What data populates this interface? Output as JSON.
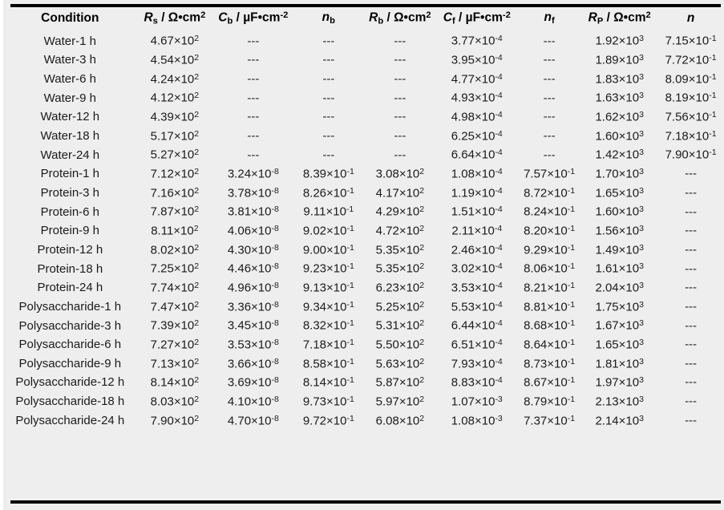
{
  "figure": {
    "background_color": "#eeeeee",
    "rule_color": "#000000",
    "text_color": "#1b1b1b"
  },
  "table": {
    "columns": [
      {
        "key": "condition",
        "label_plain": "Condition",
        "symbol": "",
        "subscript": "",
        "units": ""
      },
      {
        "key": "Rs",
        "label_plain": "Rs / Ω•cm2",
        "symbol": "R",
        "subscript": "s",
        "units": "/ Ω•cm",
        "unit_exp": "2"
      },
      {
        "key": "Cb",
        "label_plain": "Cb / µF•cm-2",
        "symbol": "C",
        "subscript": "b",
        "units": "/ µF•cm",
        "unit_exp": "-2"
      },
      {
        "key": "nb",
        "label_plain": "nb",
        "symbol": "n",
        "subscript": "b",
        "units": "",
        "unit_exp": ""
      },
      {
        "key": "Rb",
        "label_plain": "Rb / Ω•cm2",
        "symbol": "R",
        "subscript": "b",
        "units": "/ Ω•cm",
        "unit_exp": "2"
      },
      {
        "key": "Cf",
        "label_plain": "Cf / µF•cm-2",
        "symbol": "C",
        "subscript": "f",
        "units": "/ µF•cm",
        "unit_exp": "-2"
      },
      {
        "key": "nf",
        "label_plain": "nf",
        "symbol": "n",
        "subscript": "f",
        "units": "",
        "unit_exp": ""
      },
      {
        "key": "Rp",
        "label_plain": "RP / Ω•cm2",
        "symbol": "R",
        "subscript": "P",
        "units": "/ Ω•cm",
        "unit_exp": "2"
      },
      {
        "key": "n",
        "label_plain": "n",
        "symbol": "n",
        "subscript": "",
        "units": "",
        "unit_exp": ""
      }
    ],
    "no_data": "---",
    "rows": [
      {
        "condition": "Water-1 h",
        "Rs": {
          "m": "4.67",
          "e": "2"
        },
        "Cb": null,
        "nb": null,
        "Rb": null,
        "Cf": {
          "m": "3.77",
          "e": "-4"
        },
        "nf": null,
        "Rp": {
          "m": "1.92",
          "e": "3"
        },
        "n": {
          "m": "7.15",
          "e": "-1"
        }
      },
      {
        "condition": "Water-3 h",
        "Rs": {
          "m": "4.54",
          "e": "2"
        },
        "Cb": null,
        "nb": null,
        "Rb": null,
        "Cf": {
          "m": "3.95",
          "e": "-4"
        },
        "nf": null,
        "Rp": {
          "m": "1.89",
          "e": "3"
        },
        "n": {
          "m": "7.72",
          "e": "-1"
        }
      },
      {
        "condition": "Water-6 h",
        "Rs": {
          "m": "4.24",
          "e": "2"
        },
        "Cb": null,
        "nb": null,
        "Rb": null,
        "Cf": {
          "m": "4.77",
          "e": "-4"
        },
        "nf": null,
        "Rp": {
          "m": "1.83",
          "e": "3"
        },
        "n": {
          "m": "8.09",
          "e": "-1"
        }
      },
      {
        "condition": "Water-9 h",
        "Rs": {
          "m": "4.12",
          "e": "2"
        },
        "Cb": null,
        "nb": null,
        "Rb": null,
        "Cf": {
          "m": "4.93",
          "e": "-4"
        },
        "nf": null,
        "Rp": {
          "m": "1.63",
          "e": "3"
        },
        "n": {
          "m": "8.19",
          "e": "-1"
        }
      },
      {
        "condition": "Water-12 h",
        "Rs": {
          "m": "4.39",
          "e": "2"
        },
        "Cb": null,
        "nb": null,
        "Rb": null,
        "Cf": {
          "m": "4.98",
          "e": "-4"
        },
        "nf": null,
        "Rp": {
          "m": "1.62",
          "e": "3"
        },
        "n": {
          "m": "7.56",
          "e": "-1"
        }
      },
      {
        "condition": "Water-18 h",
        "Rs": {
          "m": "5.17",
          "e": "2"
        },
        "Cb": null,
        "nb": null,
        "Rb": null,
        "Cf": {
          "m": "6.25",
          "e": "-4"
        },
        "nf": null,
        "Rp": {
          "m": "1.60",
          "e": "3"
        },
        "n": {
          "m": "7.18",
          "e": "-1"
        }
      },
      {
        "condition": "Water-24 h",
        "Rs": {
          "m": "5.27",
          "e": "2"
        },
        "Cb": null,
        "nb": null,
        "Rb": null,
        "Cf": {
          "m": "6.64",
          "e": "-4"
        },
        "nf": null,
        "Rp": {
          "m": "1.42",
          "e": "3"
        },
        "n": {
          "m": "7.90",
          "e": "-1"
        }
      },
      {
        "condition": "Protein-1 h",
        "Rs": {
          "m": "7.12",
          "e": "2"
        },
        "Cb": {
          "m": "3.24",
          "e": "-8"
        },
        "nb": {
          "m": "8.39",
          "e": "-1"
        },
        "Rb": {
          "m": "3.08",
          "e": "2"
        },
        "Cf": {
          "m": "1.08",
          "e": "-4"
        },
        "nf": {
          "m": "7.57",
          "e": "-1"
        },
        "Rp": {
          "m": "1.70",
          "e": "3"
        },
        "n": null
      },
      {
        "condition": "Protein-3 h",
        "Rs": {
          "m": "7.16",
          "e": "2"
        },
        "Cb": {
          "m": "3.78",
          "e": "-8"
        },
        "nb": {
          "m": "8.26",
          "e": "-1"
        },
        "Rb": {
          "m": "4.17",
          "e": "2"
        },
        "Cf": {
          "m": "1.19",
          "e": "-4"
        },
        "nf": {
          "m": "8.72",
          "e": "-1"
        },
        "Rp": {
          "m": "1.65",
          "e": "3"
        },
        "n": null
      },
      {
        "condition": "Protein-6 h",
        "Rs": {
          "m": "7.87",
          "e": "2"
        },
        "Cb": {
          "m": "3.81",
          "e": "-8"
        },
        "nb": {
          "m": "9.11",
          "e": "-1"
        },
        "Rb": {
          "m": "4.29",
          "e": "2"
        },
        "Cf": {
          "m": "1.51",
          "e": "-4"
        },
        "nf": {
          "m": "8.24",
          "e": "-1"
        },
        "Rp": {
          "m": "1.60",
          "e": "3"
        },
        "n": null
      },
      {
        "condition": "Protein-9 h",
        "Rs": {
          "m": "8.11",
          "e": "2"
        },
        "Cb": {
          "m": "4.06",
          "e": "-8"
        },
        "nb": {
          "m": "9.02",
          "e": "-1"
        },
        "Rb": {
          "m": "4.72",
          "e": "2"
        },
        "Cf": {
          "m": "2.11",
          "e": "-4"
        },
        "nf": {
          "m": "8.20",
          "e": "-1"
        },
        "Rp": {
          "m": "1.56",
          "e": "3"
        },
        "n": null
      },
      {
        "condition": "Protein-12 h",
        "Rs": {
          "m": "8.02",
          "e": "2"
        },
        "Cb": {
          "m": "4.30",
          "e": "-8"
        },
        "nb": {
          "m": "9.00",
          "e": "-1"
        },
        "Rb": {
          "m": "5.35",
          "e": "2"
        },
        "Cf": {
          "m": "2.46",
          "e": "-4"
        },
        "nf": {
          "m": "9.29",
          "e": "-1"
        },
        "Rp": {
          "m": "1.49",
          "e": "3"
        },
        "n": null
      },
      {
        "condition": "Protein-18 h",
        "Rs": {
          "m": "7.25",
          "e": "2"
        },
        "Cb": {
          "m": "4.46",
          "e": "-8"
        },
        "nb": {
          "m": "9.23",
          "e": "-1"
        },
        "Rb": {
          "m": "5.35",
          "e": "2"
        },
        "Cf": {
          "m": "3.02",
          "e": "-4"
        },
        "nf": {
          "m": "8.06",
          "e": "-1"
        },
        "Rp": {
          "m": "1.61",
          "e": "3"
        },
        "n": null
      },
      {
        "condition": "Protein-24 h",
        "Rs": {
          "m": "7.74",
          "e": "2"
        },
        "Cb": {
          "m": "4.96",
          "e": "-8"
        },
        "nb": {
          "m": "9.13",
          "e": "-1"
        },
        "Rb": {
          "m": "6.23",
          "e": "2"
        },
        "Cf": {
          "m": "3.53",
          "e": "-4"
        },
        "nf": {
          "m": "8.21",
          "e": "-1"
        },
        "Rp": {
          "m": "2.04",
          "e": "3"
        },
        "n": null
      },
      {
        "condition": "Polysaccharide-1 h",
        "Rs": {
          "m": "7.47",
          "e": "2"
        },
        "Cb": {
          "m": "3.36",
          "e": "-8"
        },
        "nb": {
          "m": "9.34",
          "e": "-1"
        },
        "Rb": {
          "m": "5.25",
          "e": "2"
        },
        "Cf": {
          "m": "5.53",
          "e": "-4"
        },
        "nf": {
          "m": "8.81",
          "e": "-1"
        },
        "Rp": {
          "m": "1.75",
          "e": "3"
        },
        "n": null
      },
      {
        "condition": "Polysaccharide-3 h",
        "Rs": {
          "m": "7.39",
          "e": "2"
        },
        "Cb": {
          "m": "3.45",
          "e": "-8"
        },
        "nb": {
          "m": "8.32",
          "e": "-1"
        },
        "Rb": {
          "m": "5.31",
          "e": "2"
        },
        "Cf": {
          "m": "6.44",
          "e": "-4"
        },
        "nf": {
          "m": "8.68",
          "e": "-1"
        },
        "Rp": {
          "m": "1.67",
          "e": "3"
        },
        "n": null
      },
      {
        "condition": "Polysaccharide-6 h",
        "Rs": {
          "m": "7.27",
          "e": "2"
        },
        "Cb": {
          "m": "3.53",
          "e": "-8"
        },
        "nb": {
          "m": "7.18",
          "e": "-1"
        },
        "Rb": {
          "m": "5.50",
          "e": "2"
        },
        "Cf": {
          "m": "6.51",
          "e": "-4"
        },
        "nf": {
          "m": "8.64",
          "e": "-1"
        },
        "Rp": {
          "m": "1.65",
          "e": "3"
        },
        "n": null
      },
      {
        "condition": "Polysaccharide-9 h",
        "Rs": {
          "m": "7.13",
          "e": "2"
        },
        "Cb": {
          "m": "3.66",
          "e": "-8"
        },
        "nb": {
          "m": "8.58",
          "e": "-1"
        },
        "Rb": {
          "m": "5.63",
          "e": "2"
        },
        "Cf": {
          "m": "7.93",
          "e": "-4"
        },
        "nf": {
          "m": "8.73",
          "e": "-1"
        },
        "Rp": {
          "m": "1.81",
          "e": "3"
        },
        "n": null
      },
      {
        "condition": "Polysaccharide-12 h",
        "Rs": {
          "m": "8.14",
          "e": "2"
        },
        "Cb": {
          "m": "3.69",
          "e": "-8"
        },
        "nb": {
          "m": "8.14",
          "e": "-1"
        },
        "Rb": {
          "m": "5.87",
          "e": "2"
        },
        "Cf": {
          "m": "8.83",
          "e": "-4"
        },
        "nf": {
          "m": "8.67",
          "e": "-1"
        },
        "Rp": {
          "m": "1.97",
          "e": "3"
        },
        "n": null
      },
      {
        "condition": "Polysaccharide-18 h",
        "Rs": {
          "m": "8.03",
          "e": "2"
        },
        "Cb": {
          "m": "4.10",
          "e": "-8"
        },
        "nb": {
          "m": "9.73",
          "e": "-1"
        },
        "Rb": {
          "m": "5.97",
          "e": "2"
        },
        "Cf": {
          "m": "1.07",
          "e": "-3"
        },
        "nf": {
          "m": "8.79",
          "e": "-1"
        },
        "Rp": {
          "m": "2.13",
          "e": "3"
        },
        "n": null
      },
      {
        "condition": "Polysaccharide-24 h",
        "Rs": {
          "m": "7.90",
          "e": "2"
        },
        "Cb": {
          "m": "4.70",
          "e": "-8"
        },
        "nb": {
          "m": "9.72",
          "e": "-1"
        },
        "Rb": {
          "m": "6.08",
          "e": "2"
        },
        "Cf": {
          "m": "1.08",
          "e": "-3"
        },
        "nf": {
          "m": "7.37",
          "e": "-1"
        },
        "Rp": {
          "m": "2.14",
          "e": "3"
        },
        "n": null
      }
    ]
  }
}
